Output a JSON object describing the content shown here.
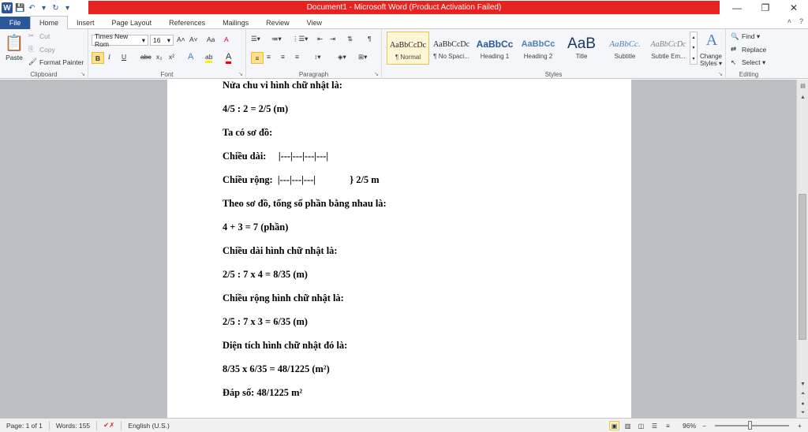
{
  "window": {
    "title": "Document1 - Microsoft Word (Product Activation Failed)",
    "minimize": "—",
    "maximize": "❐",
    "close": "✕"
  },
  "qat": {
    "logo": "W",
    "save": "💾",
    "undo": "↶",
    "undo_drop": "▾",
    "redo": "↻",
    "customize": "▾"
  },
  "tabs": {
    "file": "File",
    "items": [
      "Home",
      "Insert",
      "Page Layout",
      "References",
      "Mailings",
      "Review",
      "View"
    ],
    "active": "Home",
    "right_help": "?",
    "right_min": "˄"
  },
  "ribbon": {
    "clipboard": {
      "label": "Clipboard",
      "paste": "Paste",
      "cut": "Cut",
      "copy": "Copy",
      "format_painter": "Format Painter"
    },
    "font": {
      "label": "Font",
      "name": "Times New Rom",
      "size": "16",
      "grow": "A˄",
      "shrink": "A˅",
      "case": "Aa",
      "clear": "A",
      "bold": "B",
      "italic": "I",
      "underline": "U",
      "strike": "abc",
      "sub": "x₂",
      "sup": "x²",
      "effects": "A",
      "highlight": "ab",
      "color": "A"
    },
    "paragraph": {
      "label": "Paragraph"
    },
    "styles": {
      "label": "Styles",
      "items": [
        {
          "preview": "AaBbCcDc",
          "name": "¶ Normal"
        },
        {
          "preview": "AaBbCcDc",
          "name": "¶ No Spaci..."
        },
        {
          "preview": "AaBbCc",
          "name": "Heading 1"
        },
        {
          "preview": "AaBbCc",
          "name": "Heading 2"
        },
        {
          "preview": "AaB",
          "name": "Title"
        },
        {
          "preview": "AaBbCc.",
          "name": "Subtitle"
        },
        {
          "preview": "AaBbCcDc",
          "name": "Subtle Em..."
        }
      ],
      "change": "Change Styles",
      "change_line1": "Change",
      "change_line2": "Styles ▾"
    },
    "editing": {
      "label": "Editing",
      "find": "Find ▾",
      "replace": "Replace",
      "select": "Select ▾"
    }
  },
  "document": {
    "lines": [
      "Nửa chu vi hình chữ nhật là:",
      "4/5 : 2 = 2/5 (m)",
      "Ta có sơ đồ:",
      "Chiều dài:     |---|---|---|---|",
      "Chiều rộng:  |---|---|---|              } 2/5 m",
      "Theo sơ đồ, tổng số phần bằng nhau là:",
      "4 + 3 = 7 (phần)",
      "Chiều dài hình chữ nhật là:",
      "2/5 : 7 x 4 = 8/35 (m)",
      "Chiều rộng hình chữ nhật là:",
      "2/5 : 7 x 3 = 6/35 (m)",
      "Diện tích hình chữ nhật đó là:",
      "8/35 x 6/35 = 48/1225 (m²)",
      "Đáp số: 48/1225 m²"
    ]
  },
  "statusbar": {
    "page": "Page: 1 of 1",
    "words": "Words: 155",
    "language": "English (U.S.)",
    "zoom": "96%",
    "zoom_out": "−",
    "zoom_in": "+"
  }
}
